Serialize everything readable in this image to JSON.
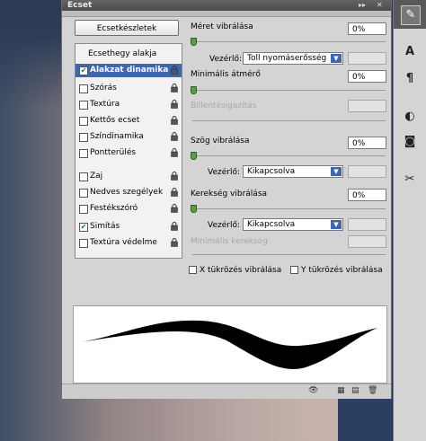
{
  "panel": {
    "title": "Ecset",
    "header_controls": [
      "▸▸",
      "✕"
    ],
    "presets_button": "Ecsetkészletek",
    "list": [
      {
        "label": "Ecsethegy alakja",
        "checkbox": false,
        "checked": false,
        "lock": false,
        "selected": false
      },
      {
        "label": "Alakzat dinamika",
        "checkbox": true,
        "checked": true,
        "lock": true,
        "selected": true
      },
      {
        "label": "Szórás",
        "checkbox": true,
        "checked": false,
        "lock": true,
        "selected": false
      },
      {
        "label": "Textúra",
        "checkbox": true,
        "checked": false,
        "lock": true,
        "selected": false
      },
      {
        "label": "Kettős ecset",
        "checkbox": true,
        "checked": false,
        "lock": true,
        "selected": false
      },
      {
        "label": "Színdinamika",
        "checkbox": true,
        "checked": false,
        "lock": true,
        "selected": false
      },
      {
        "label": "Pontterülés",
        "checkbox": true,
        "checked": false,
        "lock": true,
        "selected": false
      },
      {
        "label": "Zaj",
        "checkbox": true,
        "checked": false,
        "lock": true,
        "selected": false
      },
      {
        "label": "Nedves szegélyek",
        "checkbox": true,
        "checked": false,
        "lock": true,
        "selected": false
      },
      {
        "label": "Festékszóró",
        "checkbox": true,
        "checked": false,
        "lock": true,
        "selected": false
      },
      {
        "label": "Simítás",
        "checkbox": true,
        "checked": true,
        "lock": true,
        "selected": false
      },
      {
        "label": "Textúra védelme",
        "checkbox": true,
        "checked": false,
        "lock": true,
        "selected": false
      }
    ],
    "settings": {
      "size_jitter_label": "Méret vibrálása",
      "size_jitter_value": "0%",
      "size_control_label": "Vezérlő:",
      "size_control_value": "Toll nyomáserősség",
      "min_diameter_label": "Minimális átmérő",
      "min_diameter_value": "0%",
      "tilt_scale_label": "Billentésigazítás",
      "angle_jitter_label": "Szög vibrálása",
      "angle_jitter_value": "0%",
      "angle_control_label": "Vezérlő:",
      "angle_control_value": "Kikapcsolva",
      "roundness_jitter_label": "Kerekség vibrálása",
      "roundness_jitter_value": "0%",
      "roundness_control_label": "Vezérlő:",
      "roundness_control_value": "Kikapcsolva",
      "min_roundness_label": "Minimális kerekség",
      "flip_x_label": "X tükrözés vibrálása",
      "flip_y_label": "Y tükrözés vibrálása"
    },
    "bottom_icons": [
      "eye-icon",
      "grid-icon",
      "new-preset-icon",
      "trash-icon"
    ]
  },
  "dock": {
    "icons": [
      "brush-icon",
      "text-A-icon",
      "paragraph-icon",
      "adjustments-icon",
      "mask-icon",
      "tools-icon"
    ],
    "labels": [
      "A",
      "¶"
    ]
  },
  "colors": {
    "accent": "#3b67b5",
    "panel_bg": "#d4d4d4",
    "slider_thumb": "#5e9c4a"
  }
}
